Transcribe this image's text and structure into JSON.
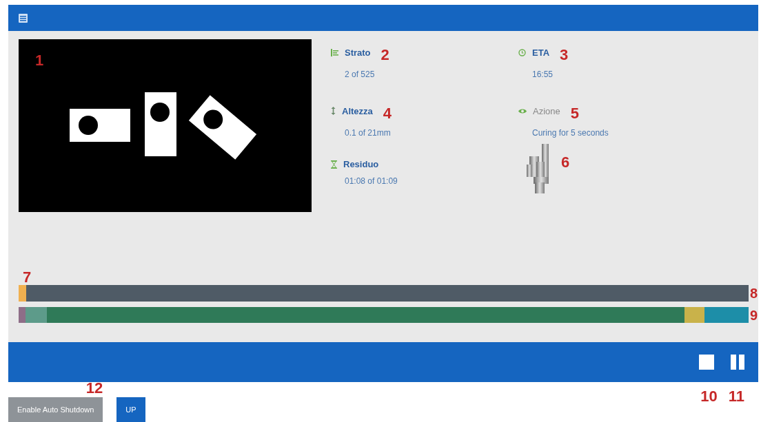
{
  "preview": {
    "kind": "picture",
    "callout": "1"
  },
  "stats": [
    {
      "kind": "layers",
      "label": "Strato",
      "value": "2 of 525",
      "dimmed": false,
      "callout": "2"
    },
    {
      "kind": "clock",
      "label": "ETA",
      "value": "16:55",
      "dimmed": false,
      "callout": "3"
    },
    {
      "kind": "height",
      "label": "Altezza",
      "value": "0.1 of 21mm",
      "dimmed": false,
      "callout": "4"
    },
    {
      "kind": "eye",
      "label": "Azione",
      "value": "Curing for 5 seconds",
      "dimmed": true,
      "callout": "5"
    },
    {
      "kind": "hourglass",
      "label": "Residuo",
      "value": "01:08 of 01:09",
      "dimmed": false
    }
  ],
  "model": {
    "callout": "6"
  },
  "progress": {
    "level": 0.01,
    "callout_above": "7",
    "callout": "8"
  },
  "segment_bar": {
    "callout": "9",
    "segments": [
      {
        "color": "#8e6e88"
      },
      {
        "color": "#5d9b8a"
      },
      {
        "color": "#2f7a58"
      },
      {
        "color": "#c9b24a"
      },
      {
        "color": "#1d8ea8"
      }
    ]
  },
  "controls": [
    {
      "kind": "stop",
      "callout": "10"
    },
    {
      "kind": "pause",
      "callout": "11"
    }
  ],
  "buttons": [
    {
      "kind": "secondary",
      "label": "Enable Auto Shutdown",
      "callout": "12"
    },
    {
      "kind": "primary",
      "label": "UP"
    }
  ]
}
